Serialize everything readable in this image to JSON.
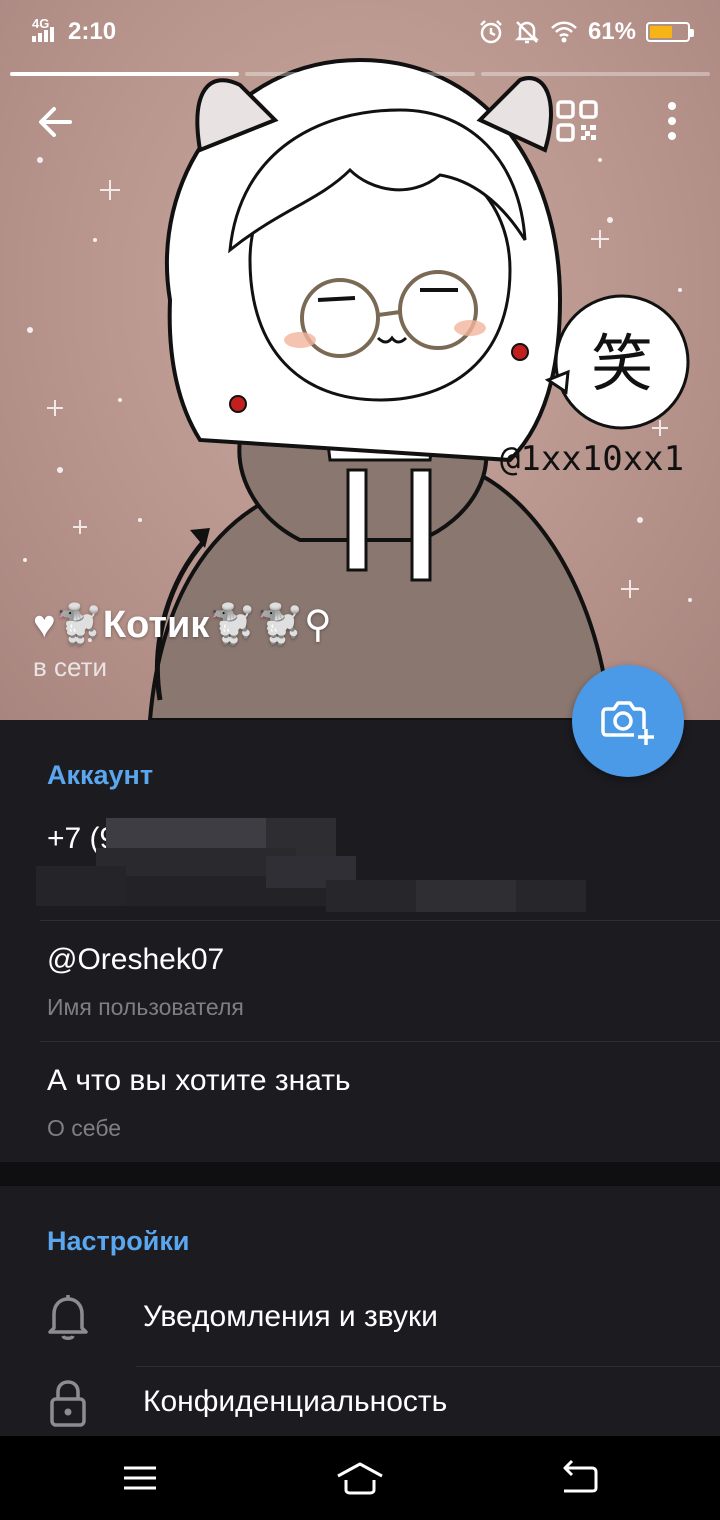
{
  "status_bar": {
    "network": "4G",
    "time": "2:10",
    "battery_percent": "61%",
    "battery_level": 0.61,
    "icons": [
      "alarm-icon",
      "mute-icon",
      "wifi-icon",
      "battery-icon"
    ]
  },
  "header": {
    "avatar_watermark": "@1xx10xx1",
    "avatar_bubble_char": "笑",
    "story_segments": 3,
    "active_segment": 1
  },
  "profile": {
    "name": "♥🐩Котик🐩🐩⚲",
    "status": "в сети"
  },
  "account": {
    "section_title": "Аккаунт",
    "phone": "+7 (9",
    "username": "@Oreshek07",
    "username_label": "Имя пользователя",
    "bio": "А что вы хотите знать",
    "bio_label": "О себе"
  },
  "settings": {
    "section_title": "Настройки",
    "items": [
      {
        "label": "Уведомления и звуки",
        "icon": "bell-icon"
      },
      {
        "label": "Конфиденциальность",
        "icon": "lock-icon"
      }
    ]
  },
  "colors": {
    "accent": "#4a9ae8",
    "section_title": "#5aa7ef",
    "background": "#1c1b20",
    "battery_fill": "#f6b416"
  }
}
